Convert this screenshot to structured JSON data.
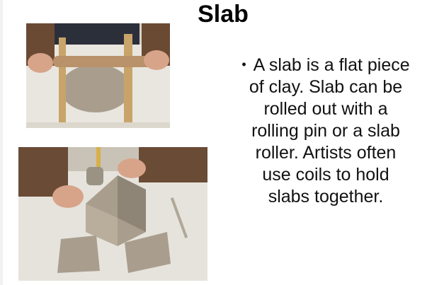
{
  "slide": {
    "title": "Slab",
    "bullet_lines": [
      "A slab is a flat piece",
      "of clay. Slab can be",
      "rolled out with a",
      "rolling pin or a slab",
      "roller. Artists often",
      "use coils to hold",
      "slabs together."
    ],
    "bullet_symbol": "•"
  },
  "images": {
    "top": {
      "subject": "hands rolling clay slab with rolling pin between two wooden guide sticks"
    },
    "bottom": {
      "subject": "hands assembling clay slab box with slip jar and brush"
    }
  },
  "colors": {
    "background": "#ffffff",
    "text": "#111111",
    "clay": "#a99e8e",
    "wood": "#c8a46a",
    "cloth": "#e9e6df"
  }
}
